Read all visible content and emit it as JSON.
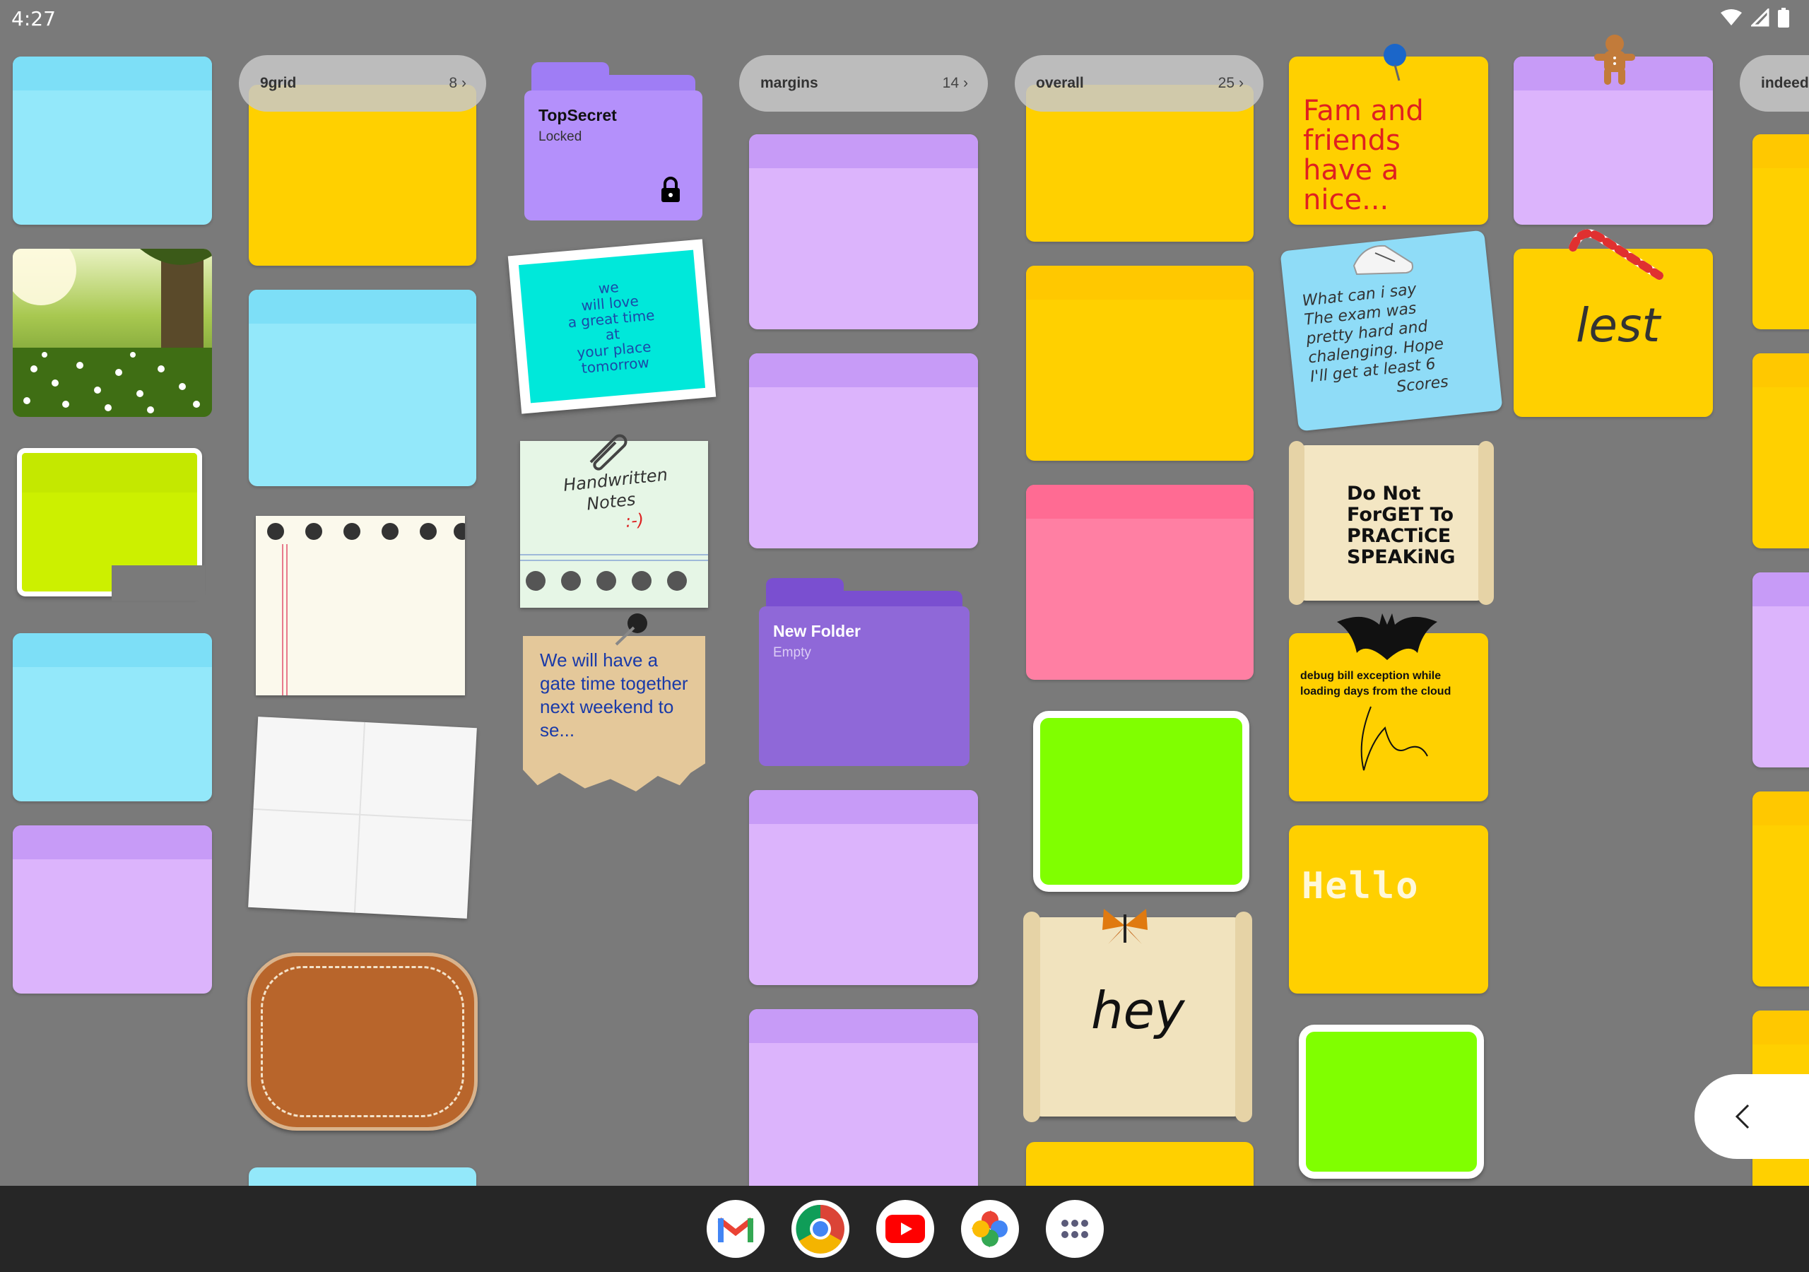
{
  "status_bar": {
    "time": "4:27"
  },
  "folders": [
    {
      "name": "9grid",
      "count": "8"
    },
    {
      "name": "margins",
      "count": "14"
    },
    {
      "name": "overall",
      "count": "25"
    },
    {
      "name": "indeed"
    }
  ],
  "folder_cards": [
    {
      "name": "TopSecret",
      "status": "Locked"
    },
    {
      "name": "New Folder",
      "status": "Empty"
    }
  ],
  "notes": {
    "teal_note": [
      "we",
      "will love",
      "a great time",
      "at",
      "your place",
      "tomorrow"
    ],
    "handwritten": [
      "Handwritten",
      "Notes",
      ":-)"
    ],
    "kraft_note": "We will have a gate time together next weekend to se...",
    "fam_note": [
      "Fam and",
      "friends",
      "have a nice..."
    ],
    "exam_note": [
      "What can i say",
      "The exam was",
      "pretty hard and",
      "chalenging. Hope",
      "I'll get at least 6",
      "Scores"
    ],
    "scroll_note": [
      "Do Not",
      "ForGET To",
      "PRACTiCE",
      "SPEAKiNG"
    ],
    "debug_note": "debug bill exception while loading days from the cloud",
    "hello_note": "Hello",
    "hey_scroll": "hey",
    "signature_text": "lest"
  },
  "dock": {
    "apps": [
      "gmail-icon",
      "chrome-icon",
      "youtube-icon",
      "photos-icon",
      "app-drawer-icon"
    ]
  },
  "colors": {
    "background": "#7a7a7a",
    "blue": "#93e8fa",
    "purple": "#dcb4fc",
    "yellow": "#ffd000",
    "pink": "#ff7fa3",
    "green": "#80ff00",
    "lime": "#ccf000",
    "folder_purple": "#b490fb",
    "folder_dark_purple": "#8f68d8"
  }
}
